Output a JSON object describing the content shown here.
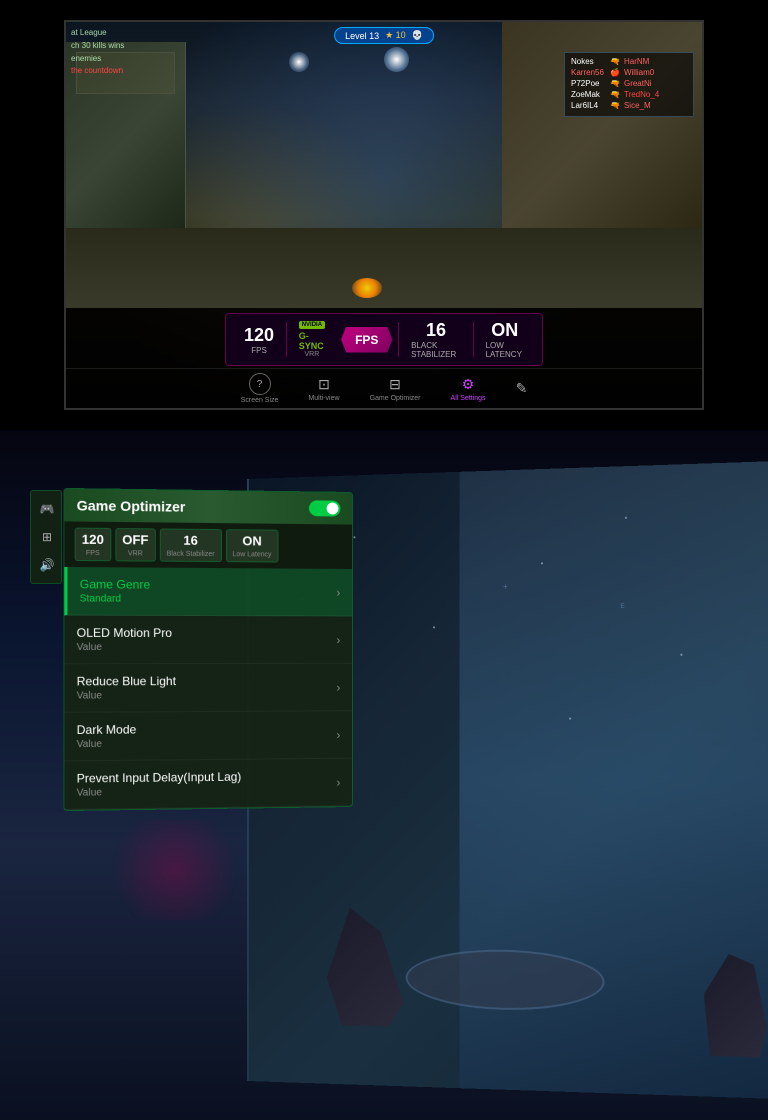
{
  "top": {
    "hud": {
      "level": "Level 13",
      "stars": "★ 10",
      "killFeed": {
        "line1": "at League",
        "line2": "ch 30 kills wins",
        "line3": "enemies",
        "line4": "the countdown"
      },
      "scoreboard": {
        "rows": [
          {
            "name": "Nokes",
            "weapon": "🔫",
            "kills": "HarNM"
          },
          {
            "name": "Karren56",
            "weapon": "🍎",
            "kills": "William0"
          },
          {
            "name": "P72Poe",
            "weapon": "🔫",
            "kills": "GreatNi"
          },
          {
            "name": "ZoeMak",
            "weapon": "🔫",
            "kills": "TredNo_4"
          },
          {
            "name": "Lar6IL4",
            "weapon": "🔫",
            "kills": "Sice_M"
          }
        ]
      }
    },
    "statsBar": {
      "fps": {
        "value": "120",
        "label": "FPS"
      },
      "gsync": {
        "brand": "NVIDIA",
        "text": "G-SYNC",
        "sub": "VRR"
      },
      "fpsBadge": "FPS",
      "blackStabilizer": {
        "value": "16",
        "label": "Black Stabilizer"
      },
      "lowLatency": {
        "value": "ON",
        "label": "Low Latency"
      }
    },
    "controls": {
      "items": [
        {
          "icon": "?",
          "label": "Screen Size",
          "active": false
        },
        {
          "icon": "⊞",
          "label": "Multi-view",
          "active": false
        },
        {
          "icon": "≡",
          "label": "Game Optimizer",
          "active": false
        },
        {
          "icon": "⚙",
          "label": "All Settings",
          "active": true
        },
        {
          "icon": "✎",
          "label": "",
          "active": false
        }
      ]
    }
  },
  "bottom": {
    "sideIcons": [
      {
        "icon": "🎮",
        "active": true
      },
      {
        "icon": "⊞",
        "active": false
      },
      {
        "icon": "🔊",
        "active": false
      }
    ],
    "panel": {
      "title": "Game Optimizer",
      "toggle": "ON",
      "miniStats": [
        {
          "value": "120",
          "label": "FPS"
        },
        {
          "value": "OFF",
          "label": "VRR"
        },
        {
          "value": "16",
          "label": "Black Stabilizer"
        },
        {
          "value": "ON",
          "label": "Low Latency"
        }
      ],
      "menuItems": [
        {
          "title": "Game Genre",
          "value": "Standard",
          "highlighted": true,
          "titleColor": "green",
          "valueColor": "green"
        },
        {
          "title": "OLED Motion Pro",
          "value": "Value",
          "highlighted": false
        },
        {
          "title": "Reduce Blue Light",
          "value": "Value",
          "highlighted": false
        },
        {
          "title": "Dark Mode",
          "value": "Value",
          "highlighted": false
        },
        {
          "title": "Prevent Input Delay(Input Lag)",
          "value": "Value",
          "highlighted": false
        }
      ]
    }
  }
}
